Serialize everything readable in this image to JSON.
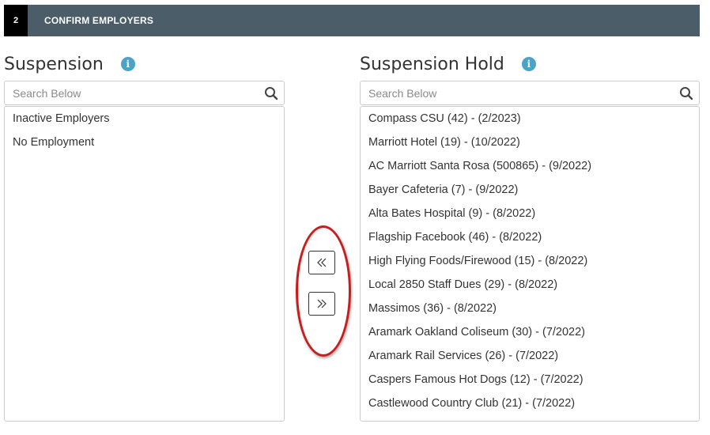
{
  "step": {
    "number": "2",
    "title": "CONFIRM EMPLOYERS"
  },
  "left_panel": {
    "title": "Suspension",
    "info_glyph": "i",
    "search_placeholder": "Search Below",
    "items": [
      "Inactive Employers",
      "No Employment"
    ]
  },
  "right_panel": {
    "title": "Suspension Hold",
    "info_glyph": "i",
    "search_placeholder": "Search Below",
    "items": [
      "Compass CSU (42) - (2/2023)",
      "Marriott Hotel (19) - (10/2022)",
      "AC Marriott Santa Rosa (500865) - (9/2022)",
      "Bayer Cafeteria (7) - (9/2022)",
      "Alta Bates Hospital (9) - (8/2022)",
      "Flagship Facebook (46) - (8/2022)",
      "High Flying Foods/Firewood (15) - (8/2022)",
      "Local 2850 Staff Dues (29) - (8/2022)",
      "Massimos (36) - (8/2022)",
      "Aramark Oakland Coliseum (30) - (7/2022)",
      "Aramark Rail Services (26) - (7/2022)",
      "Caspers Famous Hot Dogs (12) - (7/2022)",
      "Castlewood Country Club (21) - (7/2022)"
    ]
  },
  "transfer": {
    "left_icon": "double-chevron-left-icon",
    "right_icon": "double-chevron-right-icon"
  },
  "colors": {
    "header_bg": "#4a5d69",
    "step_badge_bg": "#000000",
    "info_icon": "#4aa3c8",
    "highlight_oval": "#c41e1e"
  }
}
